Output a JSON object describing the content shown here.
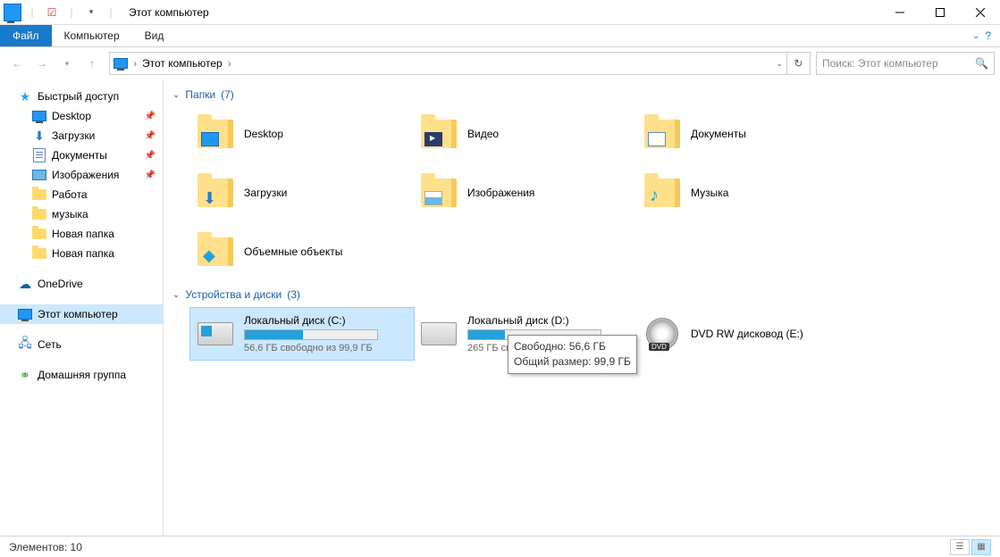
{
  "title": "Этот компьютер",
  "ribbon": {
    "file": "Файл",
    "tabs": [
      "Компьютер",
      "Вид"
    ]
  },
  "address": {
    "location": "Этот компьютер",
    "search_placeholder": "Поиск: Этот компьютер"
  },
  "sidebar": {
    "quick": "Быстрый доступ",
    "quick_items": [
      {
        "label": "Desktop",
        "pin": true,
        "icon": "desktop"
      },
      {
        "label": "Загрузки",
        "pin": true,
        "icon": "download"
      },
      {
        "label": "Документы",
        "pin": true,
        "icon": "document"
      },
      {
        "label": "Изображения",
        "pin": true,
        "icon": "image"
      },
      {
        "label": "Работа",
        "pin": false,
        "icon": "folder"
      },
      {
        "label": "музыка",
        "pin": false,
        "icon": "folder"
      },
      {
        "label": "Новая папка",
        "pin": false,
        "icon": "folder"
      },
      {
        "label": "Новая папка",
        "pin": false,
        "icon": "folder"
      }
    ],
    "onedrive": "OneDrive",
    "thispc": "Этот компьютер",
    "network": "Сеть",
    "homegroup": "Домашняя группа"
  },
  "sections": {
    "folders": {
      "title": "Папки",
      "count": "(7)"
    },
    "drives": {
      "title": "Устройства и диски",
      "count": "(3)"
    }
  },
  "folders": [
    {
      "label": "Desktop",
      "ov": "ov-desktop"
    },
    {
      "label": "Видео",
      "ov": "ov-video"
    },
    {
      "label": "Документы",
      "ov": "ov-doc"
    },
    {
      "label": "Загрузки",
      "ov": "ov-dl"
    },
    {
      "label": "Изображения",
      "ov": "ov-img"
    },
    {
      "label": "Музыка",
      "ov": "ov-music"
    },
    {
      "label": "Объемные объекты",
      "ov": "ov-3d"
    }
  ],
  "drives": [
    {
      "label": "Локальный диск (C:)",
      "free": "56,6 ГБ свободно из 99,9 ГБ",
      "fill": 44,
      "win": true,
      "selected": true
    },
    {
      "label": "Локальный диск (D:)",
      "free": "265 ГБ свободно из 365 ГБ",
      "fill": 28,
      "win": false,
      "selected": false
    },
    {
      "label": "DVD RW дисковод (E:)",
      "free": "",
      "fill": -1,
      "dvd": true,
      "selected": false
    }
  ],
  "tooltip": {
    "line1": "Свободно: 56,6 ГБ",
    "line2": "Общий размер: 99,9 ГБ"
  },
  "status": "Элементов: 10"
}
